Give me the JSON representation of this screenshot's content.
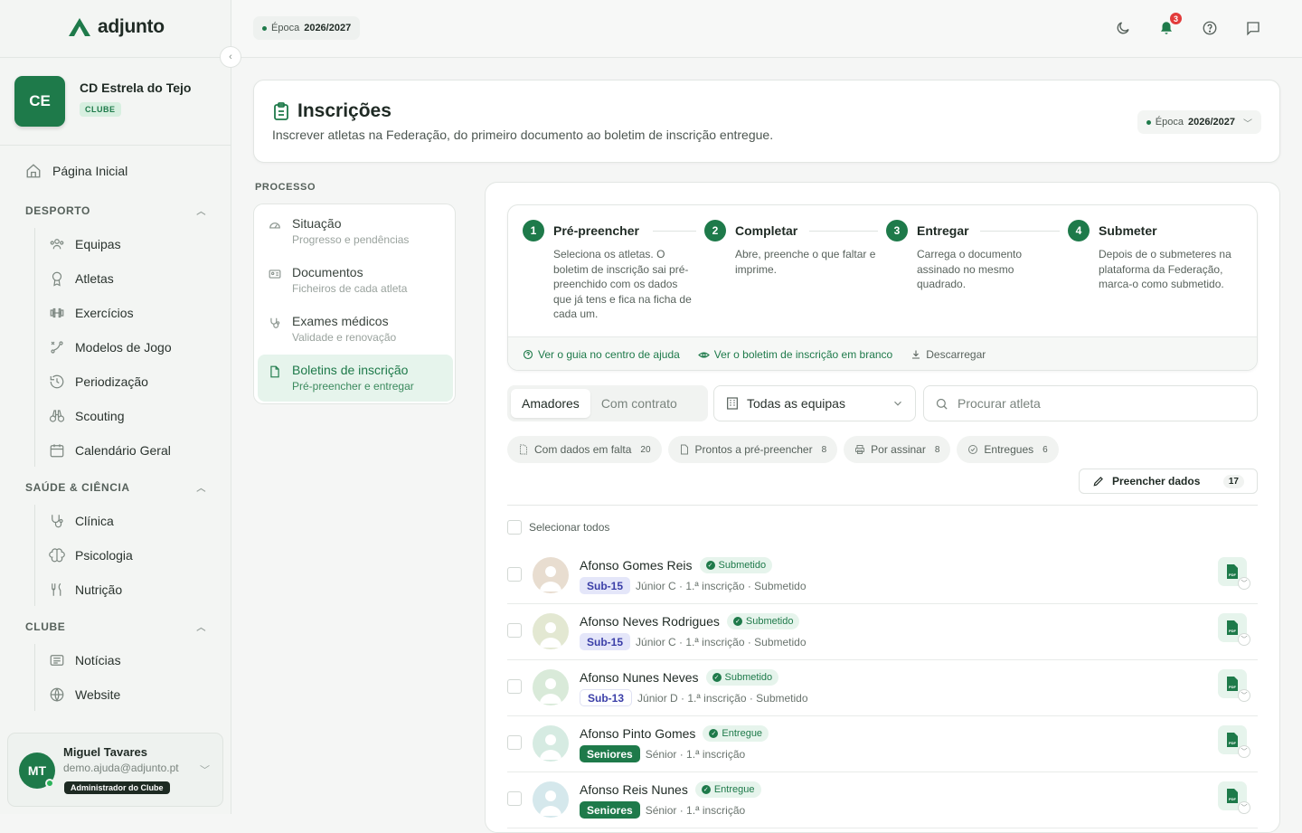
{
  "brand": {
    "name": "adjunto"
  },
  "club": {
    "initials": "CE",
    "name": "CD Estrela do Tejo",
    "tag": "CLUBE"
  },
  "nav": {
    "home": "Página Inicial",
    "sections": [
      {
        "title": "DESPORTO",
        "items": [
          "Equipas",
          "Atletas",
          "Exercícios",
          "Modelos de Jogo",
          "Periodização",
          "Scouting",
          "Calendário Geral"
        ]
      },
      {
        "title": "SAÚDE & CIÊNCIA",
        "items": [
          "Clínica",
          "Psicologia",
          "Nutrição"
        ]
      },
      {
        "title": "CLUBE",
        "items": [
          "Notícias",
          "Website"
        ]
      }
    ]
  },
  "user": {
    "initials": "MT",
    "name": "Miguel Tavares",
    "email": "demo.ajuda@adjunto.pt",
    "role": "Administrador do Clube"
  },
  "topbar": {
    "season_label": "Época",
    "season_value": "2026/2027",
    "notifications": "3"
  },
  "header": {
    "title": "Inscrições",
    "subtitle": "Inscrever atletas na Federação, do primeiro documento ao boletim de inscrição entregue.",
    "season_label": "Época",
    "season_value": "2026/2027"
  },
  "process": {
    "label": "PROCESSO",
    "items": [
      {
        "title": "Situação",
        "subtitle": "Progresso e pendências"
      },
      {
        "title": "Documentos",
        "subtitle": "Ficheiros de cada atleta"
      },
      {
        "title": "Exames médicos",
        "subtitle": "Validade e renovação"
      },
      {
        "title": "Boletins de inscrição",
        "subtitle": "Pré-preencher e entregar"
      }
    ]
  },
  "steps": [
    {
      "num": "1",
      "title": "Pré-preencher",
      "desc": "Seleciona os atletas. O boletim de inscrição sai pré-preenchido com os dados que já tens e fica na ficha de cada um."
    },
    {
      "num": "2",
      "title": "Completar",
      "desc": "Abre, preenche o que faltar e imprime."
    },
    {
      "num": "3",
      "title": "Entregar",
      "desc": "Carrega o documento assinado no mesmo quadrado."
    },
    {
      "num": "4",
      "title": "Submeter",
      "desc": "Depois de o submeteres na plataforma da Federação, marca-o como submetido."
    }
  ],
  "steps_links": {
    "guide": "Ver o guia no centro de ajuda",
    "blank": "Ver o boletim de inscrição em branco",
    "download": "Descarregar"
  },
  "tabs": [
    "Amadores",
    "Com contrato"
  ],
  "team_filter": "Todas as equipas",
  "search": {
    "placeholder": "Procurar atleta"
  },
  "chips": [
    {
      "label": "Com dados em falta",
      "count": "20"
    },
    {
      "label": "Prontos a pré-preencher",
      "count": "8"
    },
    {
      "label": "Por assinar",
      "count": "8"
    },
    {
      "label": "Entregues",
      "count": "6"
    }
  ],
  "fill_button": {
    "label": "Preencher dados",
    "count": "17"
  },
  "select_all": "Selecionar todos",
  "athletes": [
    {
      "name": "Afonso Gomes Reis",
      "status": "Submetido",
      "level": "Sub-15",
      "meta": "Júnior C · 1.ª inscrição · Submetido"
    },
    {
      "name": "Afonso Neves Rodrigues",
      "status": "Submetido",
      "level": "Sub-15",
      "meta": "Júnior C · 1.ª inscrição · Submetido"
    },
    {
      "name": "Afonso Nunes Neves",
      "status": "Submetido",
      "level": "Sub-13",
      "meta": "Júnior D · 1.ª inscrição · Submetido"
    },
    {
      "name": "Afonso Pinto Gomes",
      "status": "Entregue",
      "level": "Seniores",
      "meta": "Sénior · 1.ª inscrição"
    },
    {
      "name": "Afonso Reis Nunes",
      "status": "Entregue",
      "level": "Seniores",
      "meta": "Sénior · 1.ª inscrição"
    }
  ],
  "colors": {
    "accent": "#1e7a4a",
    "accent_light": "#e6f4ec",
    "badge": "#e23b3b"
  }
}
